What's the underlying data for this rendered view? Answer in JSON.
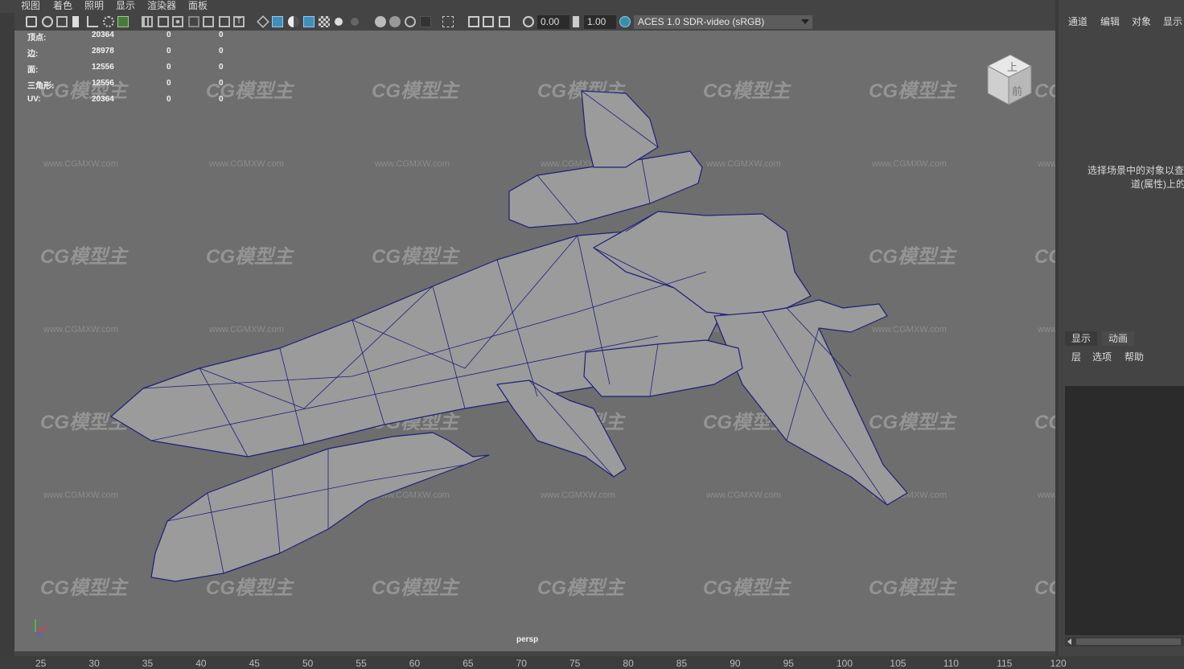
{
  "menu": [
    "视图",
    "着色",
    "照明",
    "显示",
    "渲染器",
    "面板"
  ],
  "toolbar": {
    "exposure_value": "0.00",
    "gamma_value": "1.00",
    "color_management": "ACES 1.0 SDR-video (sRGB)",
    "icons": [
      "camera-select-icon",
      "camera-attr-icon",
      "bookmark-icon",
      "image-plane-icon",
      "grid-icon",
      "film-gate-icon",
      "resolution-gate-icon",
      "wireframe-icon",
      "smooth-shade-icon",
      "textured-icon",
      "lighting-icon",
      "shadows-icon",
      "isolate-icon",
      "xray-icon",
      "exposure-icon",
      "gamma-icon",
      "color-management-icon"
    ]
  },
  "hud": {
    "rows": [
      {
        "label": "顶点:",
        "v1": "20364",
        "v2": "0",
        "v3": "0"
      },
      {
        "label": "边:",
        "v1": "28978",
        "v2": "0",
        "v3": "0"
      },
      {
        "label": "面:",
        "v1": "12556",
        "v2": "0",
        "v3": "0"
      },
      {
        "label": "三角形:",
        "v1": "12556",
        "v2": "0",
        "v3": "0"
      },
      {
        "label": "UV:",
        "v1": "20364",
        "v2": "0",
        "v3": "0"
      }
    ]
  },
  "viewcube": {
    "top_label": "上",
    "front_label": "前"
  },
  "camera_label": "persp",
  "watermark": {
    "logo_text": "CG模型主",
    "url_text": "www.CGMXW.com"
  },
  "right_panel": {
    "menu": [
      "通道",
      "编辑",
      "对象",
      "显示"
    ],
    "info_line1": "选择场景中的对象以查",
    "info_line2": "道(属性)上的",
    "layer_tabs": [
      "显示",
      "动画"
    ],
    "layer_menu": [
      "层",
      "选项",
      "帮助"
    ]
  },
  "timeline": {
    "ticks": [
      "25",
      "30",
      "35",
      "40",
      "45",
      "50",
      "55",
      "60",
      "65",
      "70",
      "75",
      "80",
      "85",
      "90",
      "95",
      "100",
      "105",
      "110",
      "115",
      "120"
    ]
  },
  "colors": {
    "viewport_bg": "#6e6e6e",
    "wire": "#1c1c78",
    "mesh_fill": "#9a9a9a",
    "ui_bg": "#444444"
  }
}
